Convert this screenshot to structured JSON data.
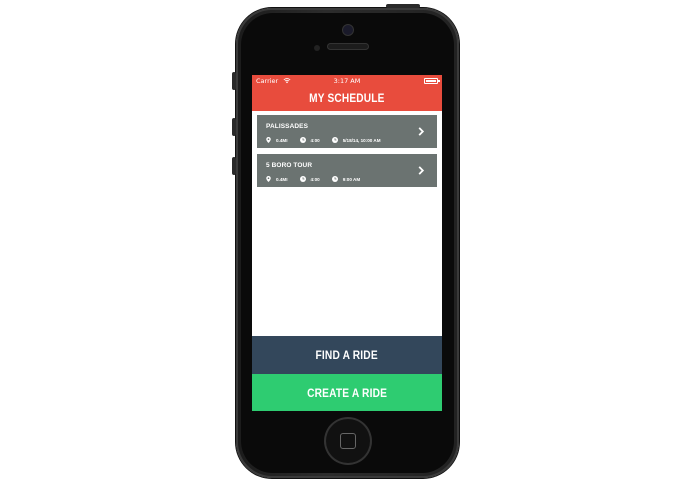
{
  "status_bar": {
    "carrier": "Carrier",
    "time": "3:17 AM"
  },
  "nav": {
    "title": "MY SCHEDULE"
  },
  "rides": [
    {
      "name": "PALISSADES",
      "distance": "0.4MI",
      "duration": "4:00",
      "datetime": "5/18/14, 10:00 AM"
    },
    {
      "name": "5 BORO TOUR",
      "distance": "0.4MI",
      "duration": "4:00",
      "datetime": "9:00 AM"
    }
  ],
  "actions": {
    "find_label": "FIND A RIDE",
    "create_label": "CREATE A RIDE"
  },
  "colors": {
    "header": "#e84c3d",
    "card": "#6b7371",
    "find": "#33475b",
    "create": "#2ecc71"
  },
  "icons": {
    "distance": "map-pin-icon",
    "duration": "clock-icon",
    "datetime": "clock-icon",
    "open": "chevron-right-icon"
  }
}
